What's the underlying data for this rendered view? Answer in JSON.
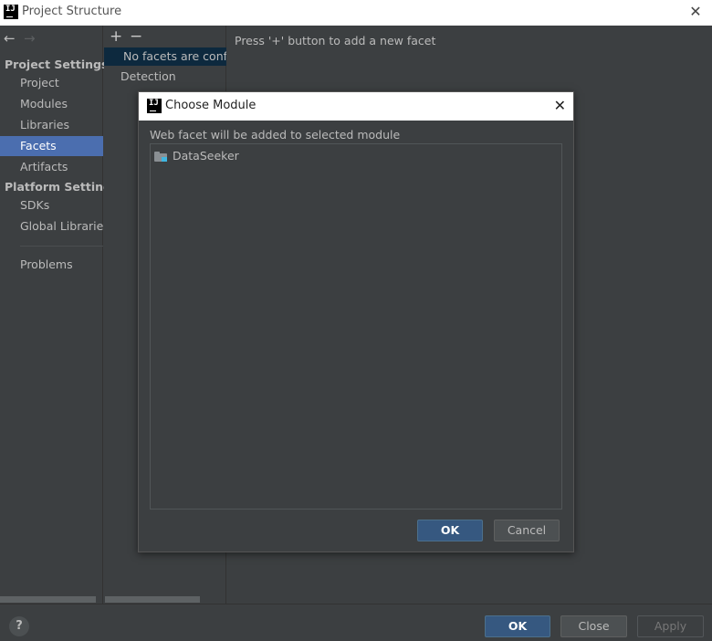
{
  "window": {
    "title": "Project Structure",
    "close_glyph": "✕"
  },
  "nav": {
    "back_glyph": "←",
    "forward_glyph": "→",
    "project_settings_heading": "Project Settings",
    "project_items": [
      "Project",
      "Modules",
      "Libraries",
      "Facets",
      "Artifacts"
    ],
    "selected_item": "Facets",
    "platform_settings_heading": "Platform Settings",
    "platform_items": [
      "SDKs",
      "Global Libraries"
    ],
    "problems": "Problems"
  },
  "facets_panel": {
    "add_glyph": "+",
    "remove_glyph": "−",
    "empty_row": "No facets are configured",
    "detection": "Detection"
  },
  "content": {
    "hint": "Press '+' button to add a new facet"
  },
  "dialog": {
    "title": "Choose Module",
    "close_glyph": "✕",
    "label": "Web facet will be added to selected module",
    "modules": [
      "DataSeeker"
    ],
    "ok_label": "OK",
    "cancel_label": "Cancel"
  },
  "footer": {
    "help_glyph": "?",
    "ok_label": "OK",
    "close_label": "Close",
    "apply_label": "Apply"
  },
  "colors": {
    "background": "#3c3f41",
    "selection": "#4b6eaf",
    "primary_button": "#365880",
    "row_highlight": "#0d293e"
  }
}
